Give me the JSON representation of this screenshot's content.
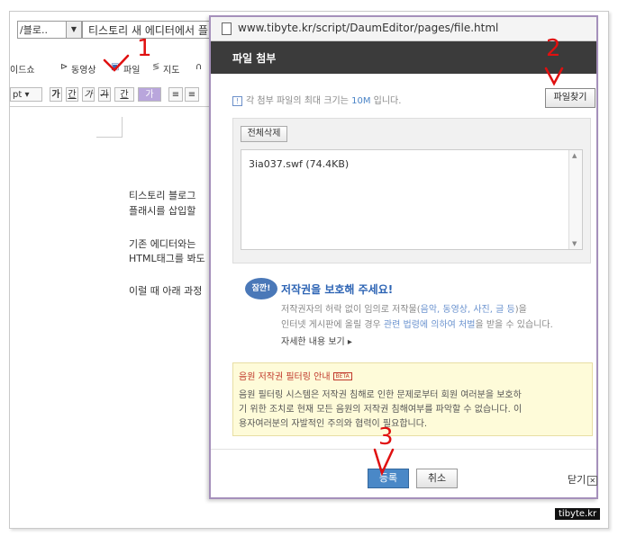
{
  "editor": {
    "category_value": "/블로..",
    "title_value": "티스토리 새 에디터에서 플",
    "toolbar": {
      "slideshow": "이드쇼",
      "video": "동영상",
      "file": "파일",
      "map": "지도",
      "font_size": "pt",
      "bold": "가",
      "underline": "간",
      "italic": "가",
      "strike": "가",
      "font_color": "간",
      "bg_color": "가"
    },
    "body_lines": [
      "티스토리 블로그",
      "플래시를 삽입할",
      "기존 에디터와는",
      "HTML태그를 봐도",
      "이럴 때 아래 과정"
    ]
  },
  "popup": {
    "url": "www.tibyte.kr/script/DaumEditor/pages/file.html",
    "header_title": "파일 첨부",
    "info_prefix": "각 첨부 파일의 최대 크기는",
    "info_size": "10M",
    "info_suffix": "입니다.",
    "find_button": "파일찾기",
    "delete_all_button": "전체삭제",
    "files": [
      "3ia037.swf (74.4KB)"
    ],
    "copyright": {
      "badge": "잠깐!",
      "title": "저작권을 보호해 주세요!",
      "line1_a": "저작권자의 허락 없이 임의로 저작물(",
      "line1_b": "음악, 동영상, 사진, 글 등",
      "line1_c": ")을",
      "line2_a": "인터넷 게시판에 올릴 경우 ",
      "line2_b": "관련 법령에 의하여 처벌",
      "line2_c": "을 받을 수 있습니다.",
      "more": "자세한 내용 보기 ▸"
    },
    "notice": {
      "title": "음원 저작권 필터링 안내",
      "beta": "BETA",
      "lines": [
        "음원 필터링 시스템은 저작권 침해로 인한 문제로부터 회원 여러분을 보호하",
        "기 위한 조치로 현재 모든 음원의 저작권 침해여부를 파악할 수 없습니다. 이",
        "용자여러분의 자발적인 주의와 협력이 필요합니다."
      ]
    },
    "ok_button": "등록",
    "cancel_button": "취소",
    "close_link": "닫기"
  },
  "annotations": {
    "n1": "1",
    "n2": "2",
    "n3": "3"
  },
  "watermark": "tibyte.kr",
  "colors": {
    "annotation": "#e01010",
    "header_bg": "#3b3b3b",
    "ok_button": "#4a88c7",
    "popup_border": "#a590bb"
  }
}
